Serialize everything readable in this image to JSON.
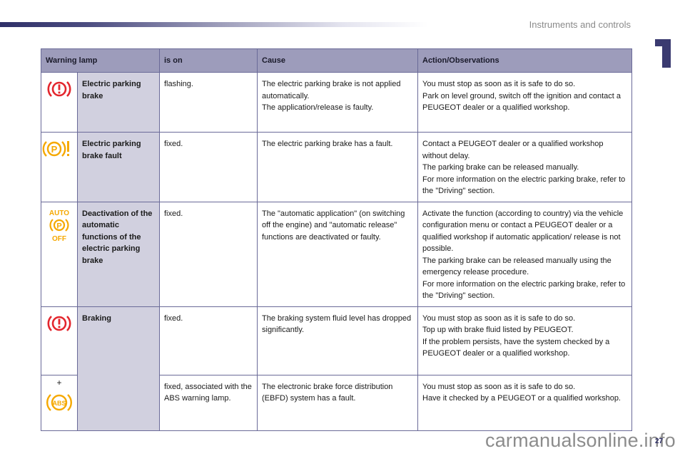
{
  "header": {
    "section_title": "Instruments and controls",
    "chapter_number": "1"
  },
  "table": {
    "columns": [
      "Warning lamp",
      "is on",
      "Cause",
      "Action/Observations"
    ],
    "rows": [
      {
        "icon": "brake-warning-icon",
        "icon_color": "#e3262d",
        "name": "Electric parking brake",
        "is_on": "flashing.",
        "cause": [
          "The electric parking brake is not applied automatically.",
          "The application/release is faulty."
        ],
        "action": [
          "You must stop as soon as it is safe to do so.",
          "Park on level ground, switch off the ignition and contact a PEUGEOT dealer or a qualified workshop."
        ]
      },
      {
        "icon": "parking-brake-fault-icon",
        "icon_color": "#f5a800",
        "name": "Electric parking brake fault",
        "is_on": "fixed.",
        "cause": [
          "The electric parking brake has a fault."
        ],
        "action": [
          "Contact a PEUGEOT dealer or a qualified workshop without delay.",
          "The parking brake can be released manually.",
          "For more information on the electric parking brake, refer to the \"Driving\" section."
        ]
      },
      {
        "icon": "auto-parking-off-icon",
        "icon_color": "#f5a800",
        "icon_text_top": "AUTO",
        "icon_text_bottom": "OFF",
        "name": "Deactivation of the automatic functions of the electric parking brake",
        "is_on": "fixed.",
        "cause": [
          "The \"automatic application\" (on switching off the engine) and \"automatic release\" functions are deactivated or faulty."
        ],
        "action": [
          "Activate the function (according to country) via the vehicle configuration menu or contact a PEUGEOT dealer or a qualified workshop if automatic application/ release is not possible.",
          "The parking brake can be released manually using the emergency release procedure.",
          "For more information on the electric parking brake, refer to the \"Driving\" section."
        ]
      },
      {
        "icon": "brake-warning-icon",
        "icon_color": "#e3262d",
        "name": "Braking",
        "is_on": "fixed.",
        "cause": [
          "The braking system fluid level has dropped significantly."
        ],
        "action": [
          "You must stop as soon as it is safe to do so.",
          "Top up with brake fluid listed by PEUGEOT.",
          "If the problem persists, have the system checked by a PEUGEOT dealer or a qualified workshop."
        ]
      },
      {
        "icon": "abs-icon",
        "icon_color": "#f5a800",
        "icon_prefix": "+",
        "icon_text": "ABS",
        "is_on": "fixed, associated with the ABS warning lamp.",
        "cause": [
          "The electronic brake force distribution (EBFD) system has a fault."
        ],
        "action": [
          "You must stop as soon as it is safe to do so.",
          "Have it checked by a PEUGEOT or a qualified workshop."
        ]
      }
    ]
  },
  "footer": {
    "page_number": "27",
    "watermark": "carmanualsonline.info"
  }
}
